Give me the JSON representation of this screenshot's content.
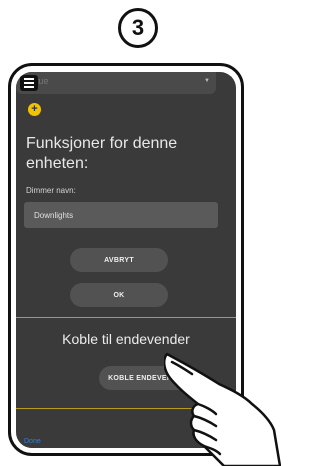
{
  "step": {
    "number": "3"
  },
  "top_select": {
    "value": "Stue"
  },
  "main": {
    "heading": "Funksjoner for denne enheten:",
    "dimmer_label": "Dimmer navn:",
    "dimmer_value": "Downlights",
    "cancel_label": "AVBRYT",
    "ok_label": "OK",
    "connect_title": "Koble til endevender",
    "connect_button_label": "KOBLE ENDEVENDER"
  },
  "footer": {
    "done_label": "Done"
  },
  "colors": {
    "screen_bg": "#3a3a3a",
    "accent_yellow": "#f2c300",
    "divider": "#b89a1e",
    "link_blue": "#2f7fe0"
  },
  "icons": [
    "menu-icon",
    "plus-icon",
    "pointing-hand-icon"
  ]
}
